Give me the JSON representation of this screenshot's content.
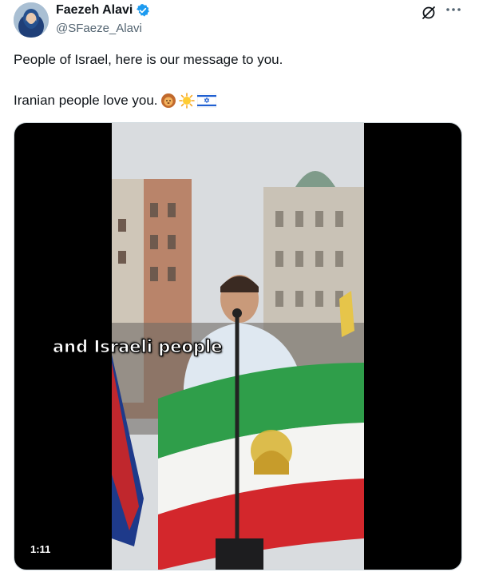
{
  "author": {
    "display_name": "Faezeh Alavi",
    "handle": "@SFaeze_Alavi",
    "verified_icon": "verified-badge-icon",
    "brand_color": "#1d9bf0"
  },
  "tweet": {
    "line1": "People of Israel, here is our message to you.",
    "line2": "Iranian people love you.",
    "emojis": [
      "lion-emoji",
      "sun-emoji",
      "israel-flag-emoji"
    ]
  },
  "video": {
    "caption": "and Israeli people",
    "duration": "1:11"
  },
  "icons": {
    "grok": "grok-icon",
    "more": "more-options-icon"
  }
}
